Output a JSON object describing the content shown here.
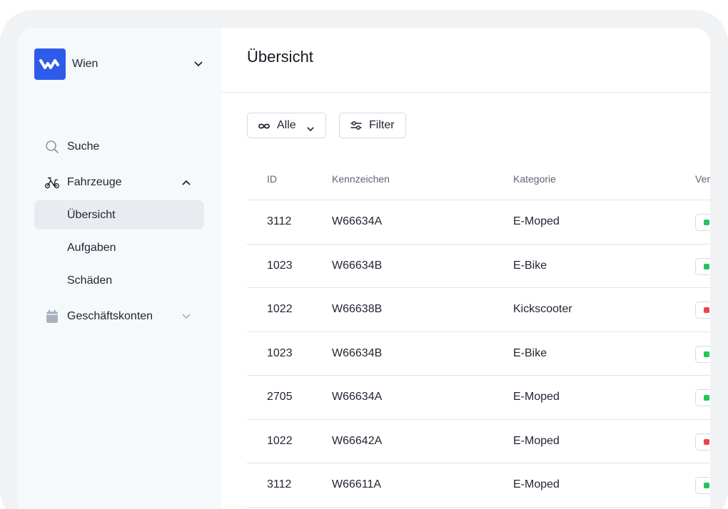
{
  "sidebar": {
    "org": {
      "name": "Wien"
    },
    "nav": [
      {
        "label": "Suche",
        "icon": "search-icon"
      },
      {
        "label": "Fahrzeuge",
        "icon": "scooter-icon",
        "expanded": true
      },
      {
        "label": "Übersicht",
        "active": true
      },
      {
        "label": "Aufgaben"
      },
      {
        "label": "Schäden"
      },
      {
        "label": "Geschäftskonten",
        "icon": "calendar-icon",
        "expanded": false
      }
    ]
  },
  "main": {
    "title": "Übersicht",
    "toolbar": {
      "all_label": "Alle",
      "filter_label": "Filter"
    },
    "table": {
      "columns": [
        "ID",
        "Kennzeichen",
        "Kategorie",
        "Ver"
      ],
      "rows": [
        {
          "id": "3112",
          "plate": "W66634A",
          "category": "E-Moped",
          "status": "green"
        },
        {
          "id": "1023",
          "plate": "W66634B",
          "category": "E-Bike",
          "status": "green"
        },
        {
          "id": "1022",
          "plate": "W66638B",
          "category": "Kickscooter",
          "status": "red"
        },
        {
          "id": "1023",
          "plate": "W66634B",
          "category": "E-Bike",
          "status": "green"
        },
        {
          "id": "2705",
          "plate": "W66634A",
          "category": "E-Moped",
          "status": "green"
        },
        {
          "id": "1022",
          "plate": "W66642A",
          "category": "E-Moped",
          "status": "red"
        },
        {
          "id": "3112",
          "plate": "W66611A",
          "category": "E-Moped",
          "status": "green"
        }
      ]
    }
  },
  "colors": {
    "brand": "#2f5bea",
    "status_green": "#22c55e",
    "status_red": "#ef4444",
    "active_nav_bg": "#e8ecf1"
  }
}
